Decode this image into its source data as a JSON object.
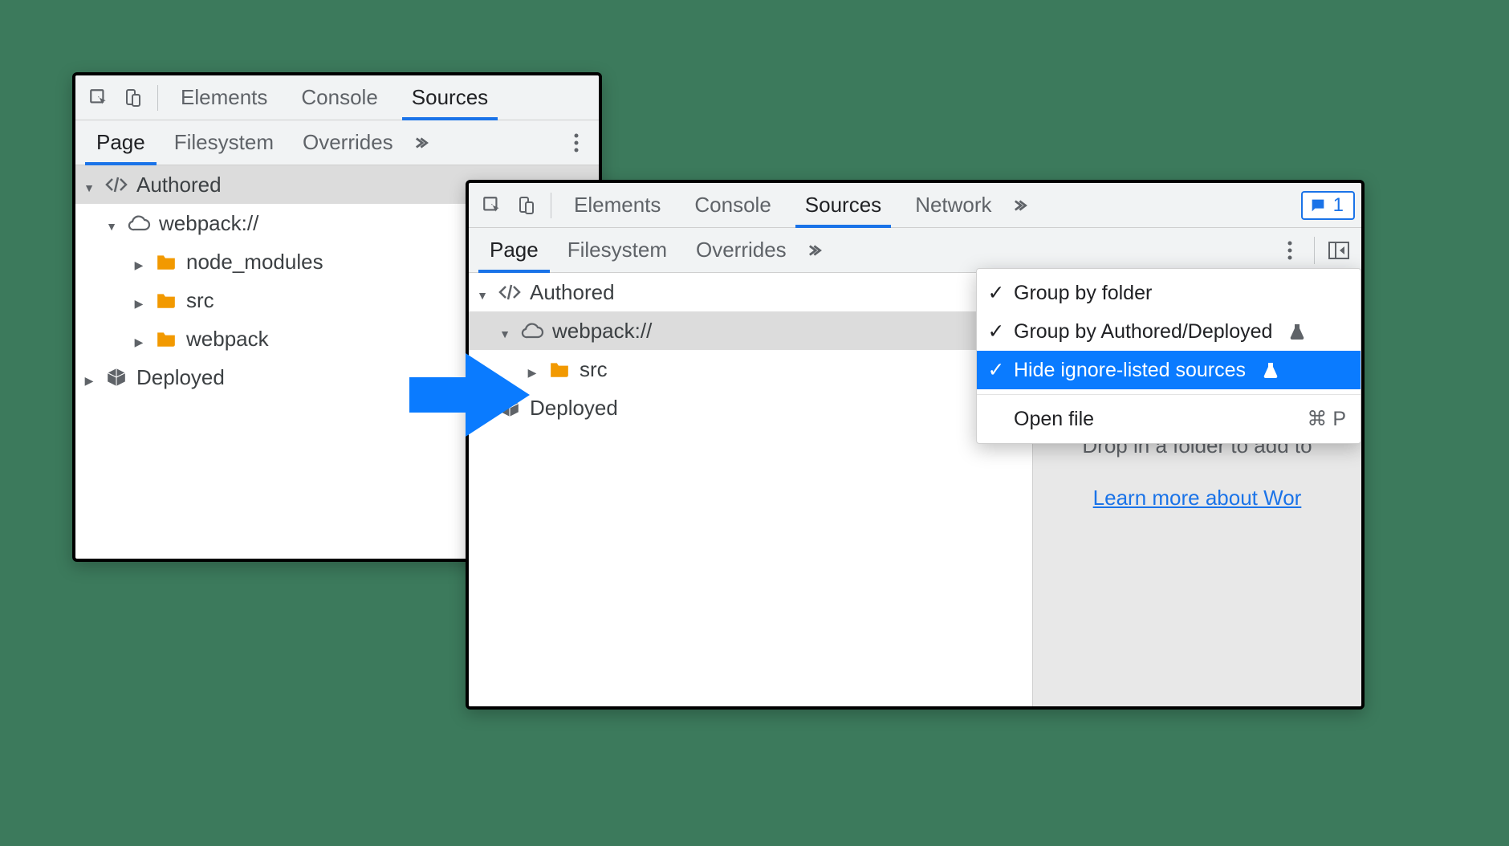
{
  "colors": {
    "accent": "#1a73e8",
    "folder": "#f29900",
    "highlight": "#0a7bff"
  },
  "left": {
    "mainTabs": {
      "t0": "Elements",
      "t1": "Console",
      "t2": "Sources"
    },
    "subTabs": {
      "s0": "Page",
      "s1": "Filesystem",
      "s2": "Overrides"
    },
    "tree": {
      "authored": "Authored",
      "webpack": "webpack://",
      "node_modules": "node_modules",
      "src": "src",
      "webpack_folder": "webpack",
      "deployed": "Deployed"
    }
  },
  "right": {
    "mainTabs": {
      "t0": "Elements",
      "t1": "Console",
      "t2": "Sources",
      "t3": "Network"
    },
    "issuesCount": "1",
    "subTabs": {
      "s0": "Page",
      "s1": "Filesystem",
      "s2": "Overrides"
    },
    "tree": {
      "authored": "Authored",
      "webpack": "webpack://",
      "src": "src",
      "deployed": "Deployed"
    },
    "empty": {
      "line1": "Drop in a folder to add to",
      "link": "Learn more about Wor"
    },
    "menu": {
      "m0": "Group by folder",
      "m1": "Group by Authored/Deployed",
      "m2": "Hide ignore-listed sources",
      "m3": "Open file",
      "shortcut": "⌘ P"
    }
  }
}
